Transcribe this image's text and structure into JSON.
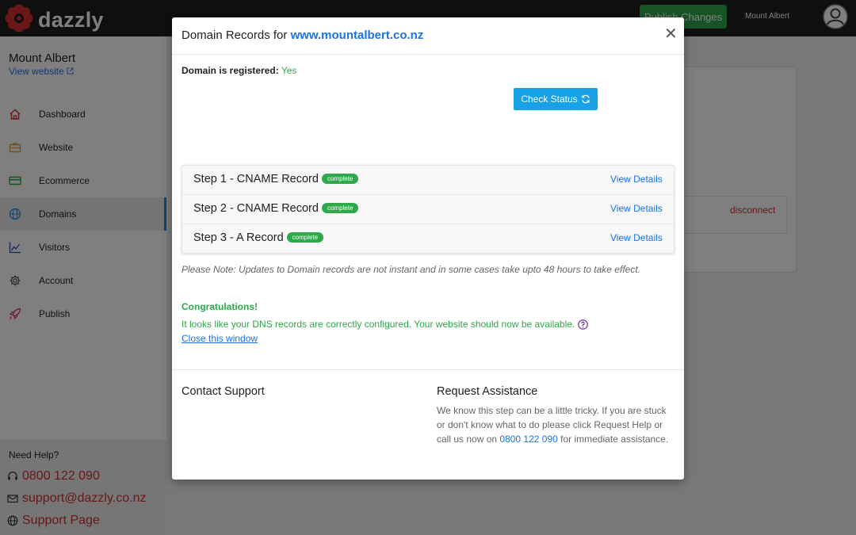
{
  "brand": {
    "name": "dazzly"
  },
  "topbar": {
    "publish_label": "Publish Changes",
    "user_name": "Mount Albert"
  },
  "sidebar": {
    "site_name": "Mount Albert",
    "view_website": "View website",
    "items": [
      {
        "label": "Dashboard",
        "icon": "home-icon"
      },
      {
        "label": "Website",
        "icon": "briefcase-icon"
      },
      {
        "label": "Ecommerce",
        "icon": "credit-card-icon"
      },
      {
        "label": "Domains",
        "icon": "globe-icon",
        "active": true
      },
      {
        "label": "Visitors",
        "icon": "chart-icon"
      },
      {
        "label": "Account",
        "icon": "gear-icon"
      },
      {
        "label": "Publish",
        "icon": "rocket-icon"
      }
    ],
    "help": {
      "title": "Need Help?",
      "phone": "0800 122 090",
      "email": "support@dazzly.co.nz",
      "support_page": "Support Page"
    }
  },
  "main": {
    "disconnect_label": "disconnect"
  },
  "modal": {
    "title_prefix": "Domain Records for",
    "domain": "www.mountalbert.co.nz",
    "registered_label": "Domain is registered:",
    "registered_value": "Yes",
    "check_status_label": "Check Status",
    "steps": [
      {
        "label": "Step 1 - CNAME Record",
        "badge": "complete",
        "link": "View Details"
      },
      {
        "label": "Step 2 - CNAME Record",
        "badge": "complete",
        "link": "View Details"
      },
      {
        "label": "Step 3 - A Record",
        "badge": "complete",
        "link": "View Details"
      }
    ],
    "note": "Please Note: Updates to Domain records are not instant and in some cases take upto 48 hours to take effect.",
    "congrats_title": "Congratulations!",
    "congrats_message": "It looks like your DNS records are correctly configured. Your website should now be available.",
    "close_link": "Close this window",
    "contact_title": "Contact Support",
    "assist_title": "Request Assistance",
    "assist_text_before": "We know this step can be a little tricky. If you are stuck or don't know what to do please click Request Help or call us now on ",
    "assist_phone": "0800 122 090",
    "assist_text_after": " for immediate assistance."
  },
  "colors": {
    "brand_red": "#d32f2f",
    "link_blue": "#1a73e8",
    "success_green": "#2ea84a",
    "button_blue": "#17a2e8",
    "topbar": "#1f1f1f"
  }
}
